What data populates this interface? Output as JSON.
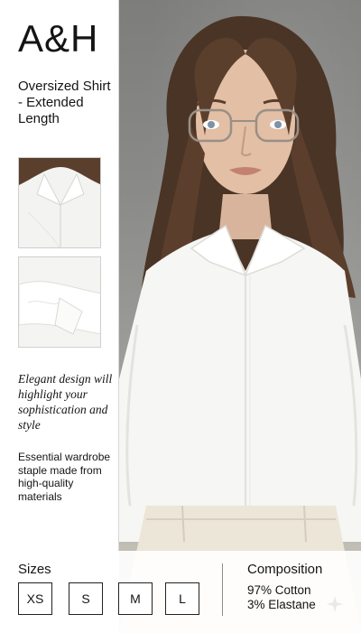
{
  "brand": {
    "logo": "A&H"
  },
  "product": {
    "title": "Oversized Shirt - Extended Length",
    "tagline": "Elegant design will highlight your sophistication and style",
    "description": "Essential wardrobe staple made from high-quality materials"
  },
  "sizes": {
    "label": "Sizes",
    "options": [
      "XS",
      "S",
      "M",
      "L"
    ]
  },
  "composition": {
    "label": "Composition",
    "lines": [
      "97% Cotton",
      "3% Elastane"
    ]
  },
  "colors": {
    "background": "#ffffff",
    "text": "#141414",
    "shirt": "#f6f6f4",
    "trousers": "#ece6d8"
  }
}
